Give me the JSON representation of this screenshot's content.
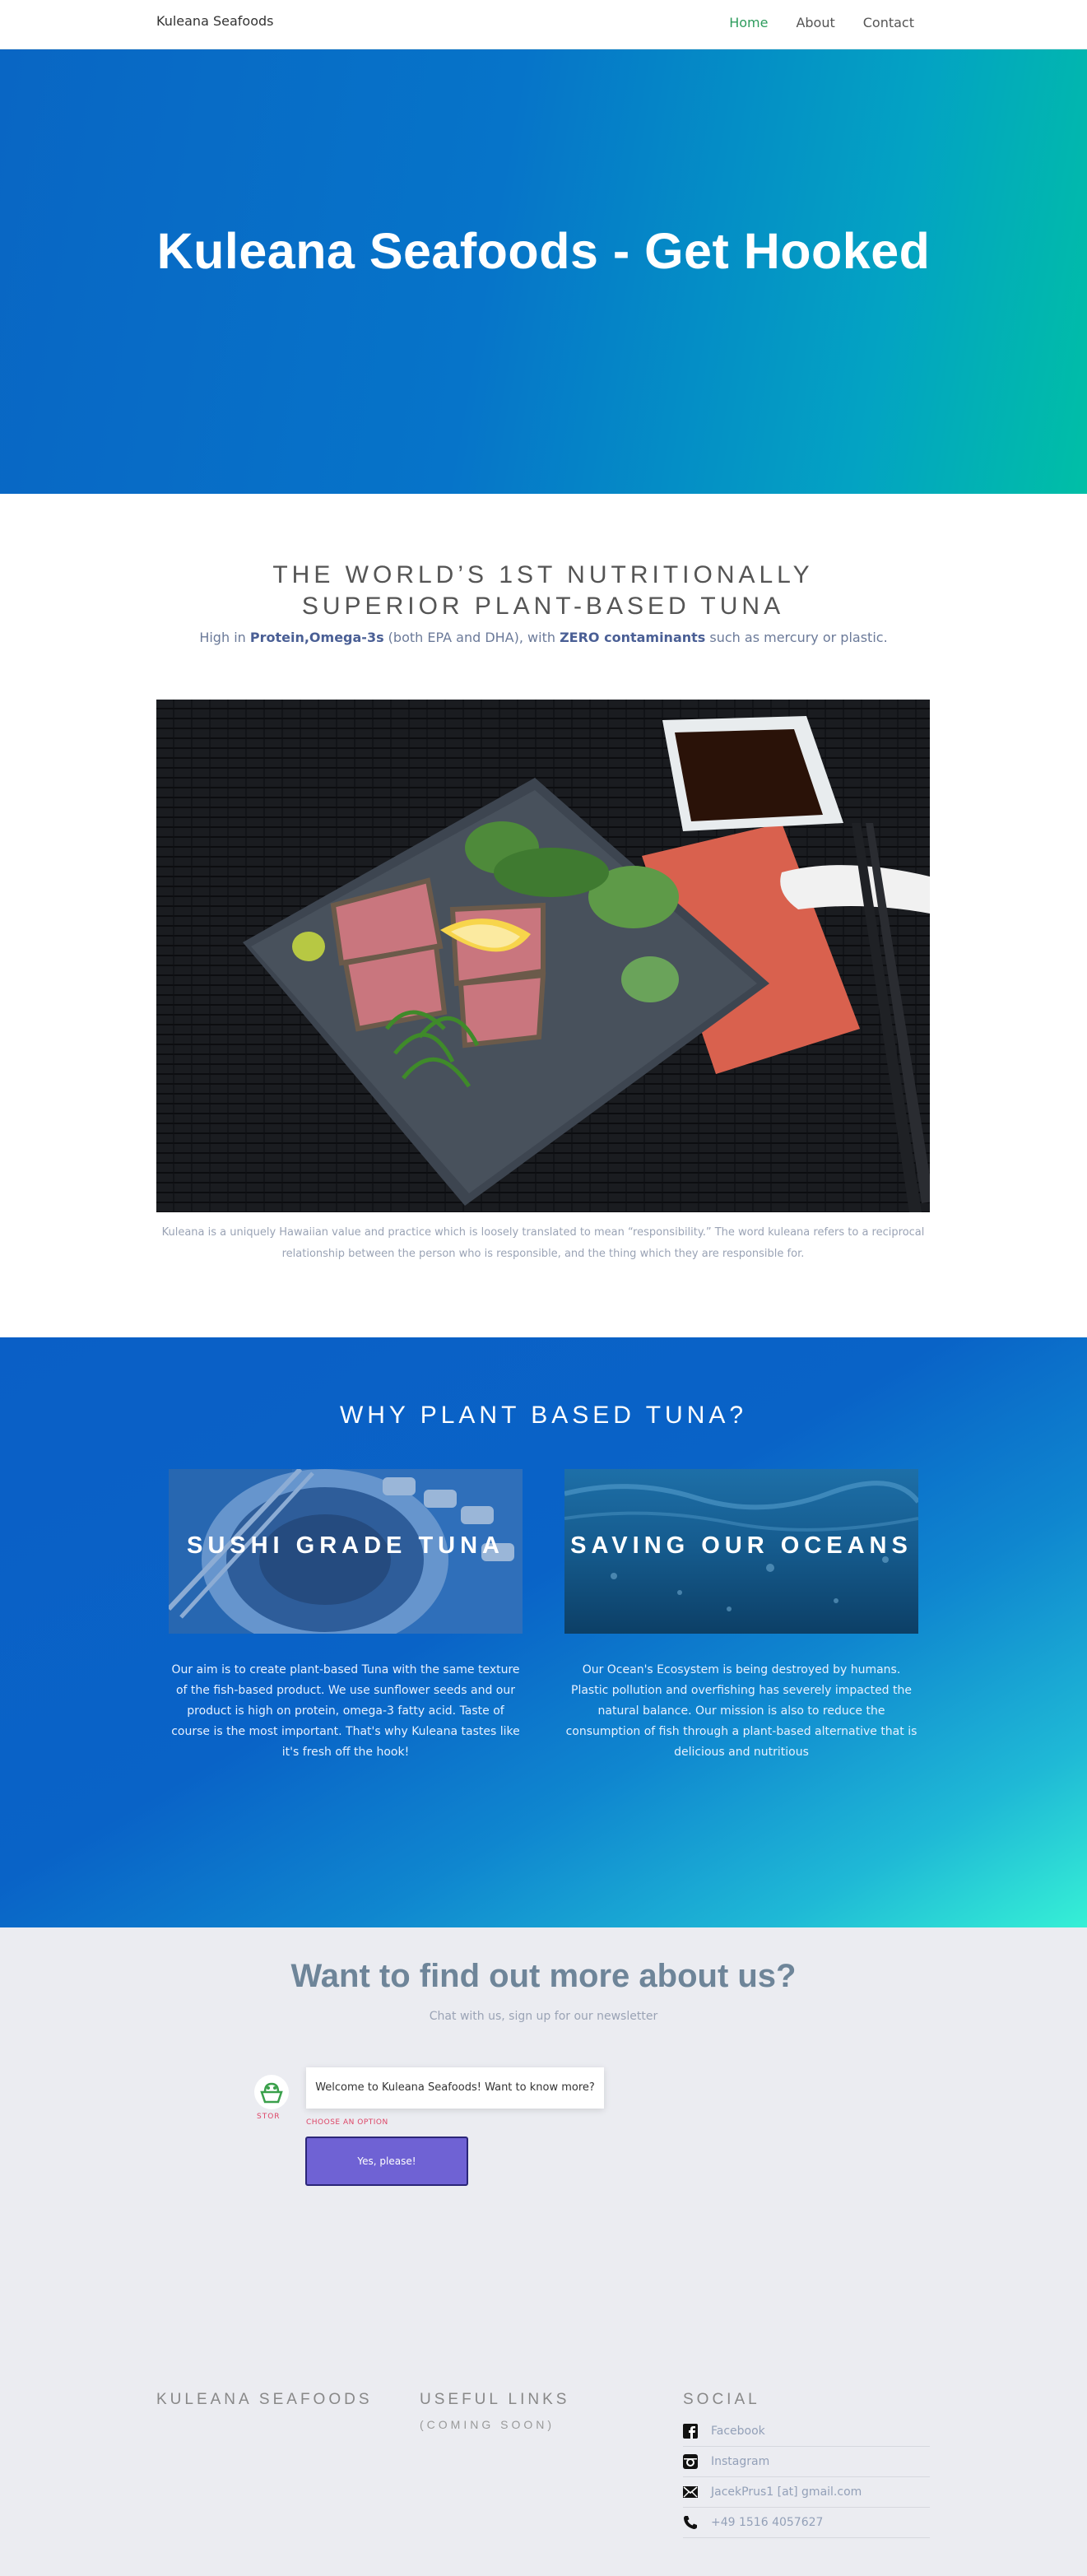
{
  "nav": {
    "brand": "Kuleana Seafoods",
    "links": [
      "Home",
      "About",
      "Contact"
    ]
  },
  "hero": {
    "title": "Kuleana Seafoods - Get Hooked"
  },
  "intro": {
    "title": "THE WORLD’S 1ST NUTRITIONALLY SUPERIOR PLANT-BASED TUNA",
    "sub_prefix": "High in ",
    "sub_bold1": "Protein,Omega-3s",
    "sub_mid": " (both EPA and DHA), with ",
    "sub_bold2": "ZERO contaminants",
    "sub_suffix": " such as mercury or plastic.",
    "caption": "Kuleana is a uniquely Hawaiian value and practice which is loosely translated to mean “responsibility.” The word kuleana refers to a reciprocal relationship between the person who is responsible, and the thing which they are responsible for."
  },
  "why": {
    "title": "WHY PLANT BASED TUNA?",
    "cards": [
      {
        "label": "SUSHI GRADE TUNA",
        "text": "Our aim is to create plant-based Tuna with the same texture of the fish-based product. We use sunflower seeds and our product is high on protein, omega-3 fatty acid. Taste of course is the most important. That's why Kuleana tastes like it's fresh off the hook!"
      },
      {
        "label": "SAVING OUR OCEANS",
        "text": "Our Ocean's Ecosystem is being destroyed by humans. Plastic pollution and overfishing has severely impacted the natural balance. Our mission is also to reduce the consumption of fish through a plant-based alternative that is delicious and nutritious"
      }
    ]
  },
  "more": {
    "title": "Want to find out more about us?",
    "sub": "Chat with us, sign up for our newsletter",
    "bot_name": "STOR",
    "bot_message": "Welcome to Kuleana Seafoods! Want to know more?",
    "choose_label": "CHOOSE AN OPTION",
    "choice": "Yes, please!"
  },
  "footer": {
    "col1_title": "KULEANA SEAFOODS",
    "col2_title": "USEFUL LINKS",
    "col2_sub": "(COMING SOON)",
    "col3_title": "SOCIAL",
    "social": [
      {
        "icon": "facebook-icon",
        "label": "Facebook"
      },
      {
        "icon": "instagram-icon",
        "label": "Instagram"
      },
      {
        "icon": "mail-icon",
        "label": "JacekPrus1 [at] gmail.com"
      },
      {
        "icon": "phone-icon",
        "label": "+49 1516 4057627"
      }
    ]
  },
  "colors": {
    "hero_start": "#0966c4",
    "hero_end": "#00bfa6",
    "nav_active": "#2e9c5d",
    "choice_button": "#6f62d4"
  }
}
